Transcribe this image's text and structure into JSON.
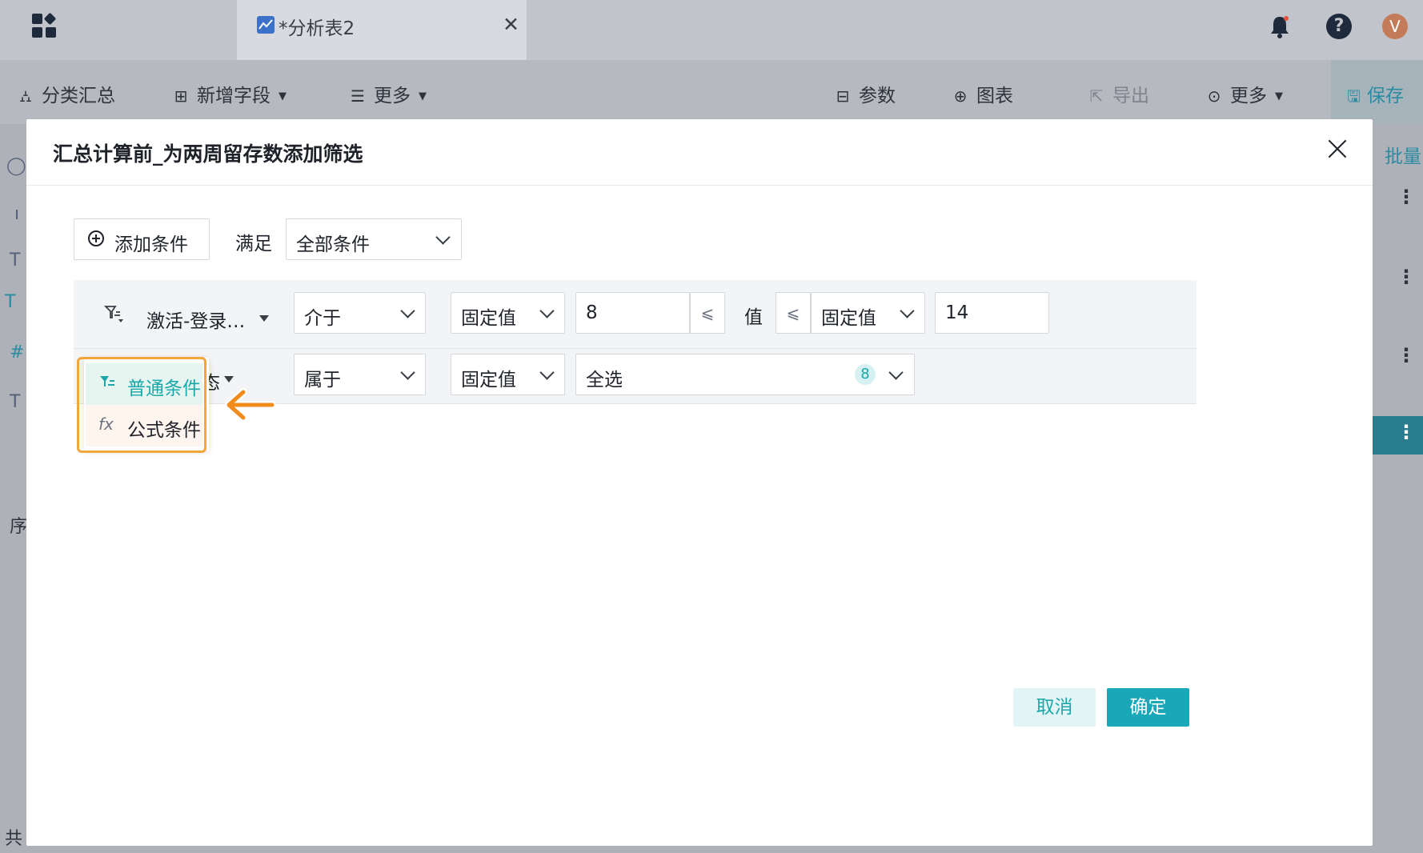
{
  "app": {
    "tab_title": "*分析表2",
    "avatar_letter": "V"
  },
  "toolbar": {
    "group_summary": "分类汇总",
    "add_field": "新增字段",
    "more_left": "更多",
    "params": "参数",
    "chart": "图表",
    "export": "导出",
    "more_right": "更多",
    "save": "保存"
  },
  "right_panel": {
    "batch": "批量"
  },
  "left_panel": {
    "seq_label": "序",
    "total_label": "共"
  },
  "dialog": {
    "title": "汇总计算前_为两周留存数添加筛选",
    "add_condition": "添加条件",
    "satisfy_label": "满足",
    "satisfy_value": "全部条件",
    "conditions": [
      {
        "field": "激活-登录…",
        "operator": "介于",
        "left_type": "固定值",
        "left_value": "8",
        "left_op": "⩽",
        "middle_word": "值",
        "right_op": "⩽",
        "right_type": "固定值",
        "right_value": "14"
      },
      {
        "field": "合作状态",
        "operator": "属于",
        "value_type": "固定值",
        "value": "全选",
        "count": "8"
      }
    ],
    "popup": {
      "items": [
        "普通条件",
        "公式条件"
      ]
    },
    "cancel": "取消",
    "confirm": "确定"
  },
  "colors": {
    "accent": "#1aa7b7",
    "highlight_frame": "#f3a73b",
    "arrow": "#f08c1c"
  }
}
